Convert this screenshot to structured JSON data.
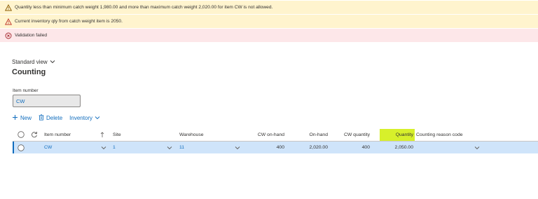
{
  "messages": [
    {
      "type": "warning",
      "icon": "warning-icon",
      "text": "Quantity less than minimum catch weight 1,980.00 and more than maximum catch weight 2,020.00 for item CW is not allowed."
    },
    {
      "type": "warning",
      "icon": "warning-icon",
      "text": "Current inventory qty from catch weight item is 2050."
    },
    {
      "type": "error",
      "icon": "error-circle-icon",
      "text": "Validation failed"
    }
  ],
  "view": {
    "label": "Standard view"
  },
  "page": {
    "title": "Counting"
  },
  "item_field": {
    "label": "Item number",
    "value": "CW"
  },
  "toolbar": {
    "new_label": "New",
    "delete_label": "Delete",
    "inventory_label": "Inventory"
  },
  "grid": {
    "columns": [
      "Item number",
      "Site",
      "Warehouse",
      "CW on-hand",
      "On-hand",
      "CW quantity",
      "Quantity",
      "Counting reason code"
    ],
    "row": {
      "item_number": "CW",
      "site": "1",
      "warehouse": "11",
      "cw_on_hand": "400",
      "on_hand": "2,020.00",
      "cw_quantity": "400",
      "quantity": "2,050.00",
      "counting_reason_code": ""
    }
  },
  "colors": {
    "accent": "#0f6cbd",
    "warning_bg": "#fff4ce",
    "error_bg": "#fde7e9",
    "highlight": "#d7f02b",
    "selected_row": "#cfe4fa"
  }
}
